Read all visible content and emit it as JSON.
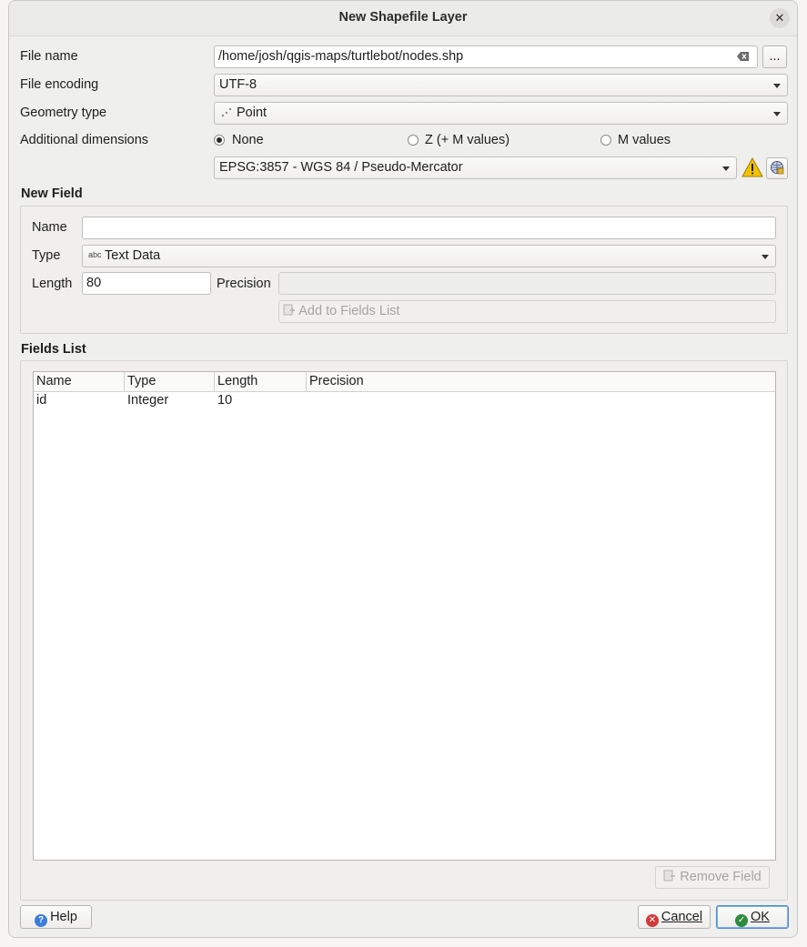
{
  "window": {
    "title": "New Shapefile Layer",
    "close_glyph": "✕"
  },
  "form": {
    "file_name_label": "File name",
    "file_name_value": "/home/josh/qgis-maps/turtlebot/nodes.shp",
    "browse_label": "...",
    "file_encoding_label": "File encoding",
    "file_encoding_value": "UTF-8",
    "geometry_type_label": "Geometry type",
    "geometry_type_value": "Point",
    "additional_dimensions_label": "Additional dimensions",
    "dim_none": "None",
    "dim_z": "Z (+ M values)",
    "dim_m": "M values",
    "dim_selected": "None",
    "crs_value": "EPSG:3857 - WGS 84 / Pseudo-Mercator"
  },
  "new_field": {
    "title": "New Field",
    "name_label": "Name",
    "name_value": "",
    "type_label": "Type",
    "type_icon_text": "abc",
    "type_value": "Text Data",
    "length_label": "Length",
    "length_value": "80",
    "precision_label": "Precision",
    "precision_value": "",
    "add_button": "Add to Fields List"
  },
  "fields_list": {
    "title": "Fields List",
    "columns": [
      "Name",
      "Type",
      "Length",
      "Precision"
    ],
    "rows": [
      {
        "name": "id",
        "type": "Integer",
        "length": "10",
        "precision": ""
      }
    ],
    "remove_button": "Remove Field"
  },
  "footer": {
    "help_button": "Help",
    "cancel_button": "Cancel",
    "ok_button": "OK"
  },
  "colors": {
    "help_icon": "#3b7dd8",
    "cancel_icon": "#d23b3b",
    "ok_icon": "#2e8b3e",
    "warning_icon": "#f2c200"
  }
}
